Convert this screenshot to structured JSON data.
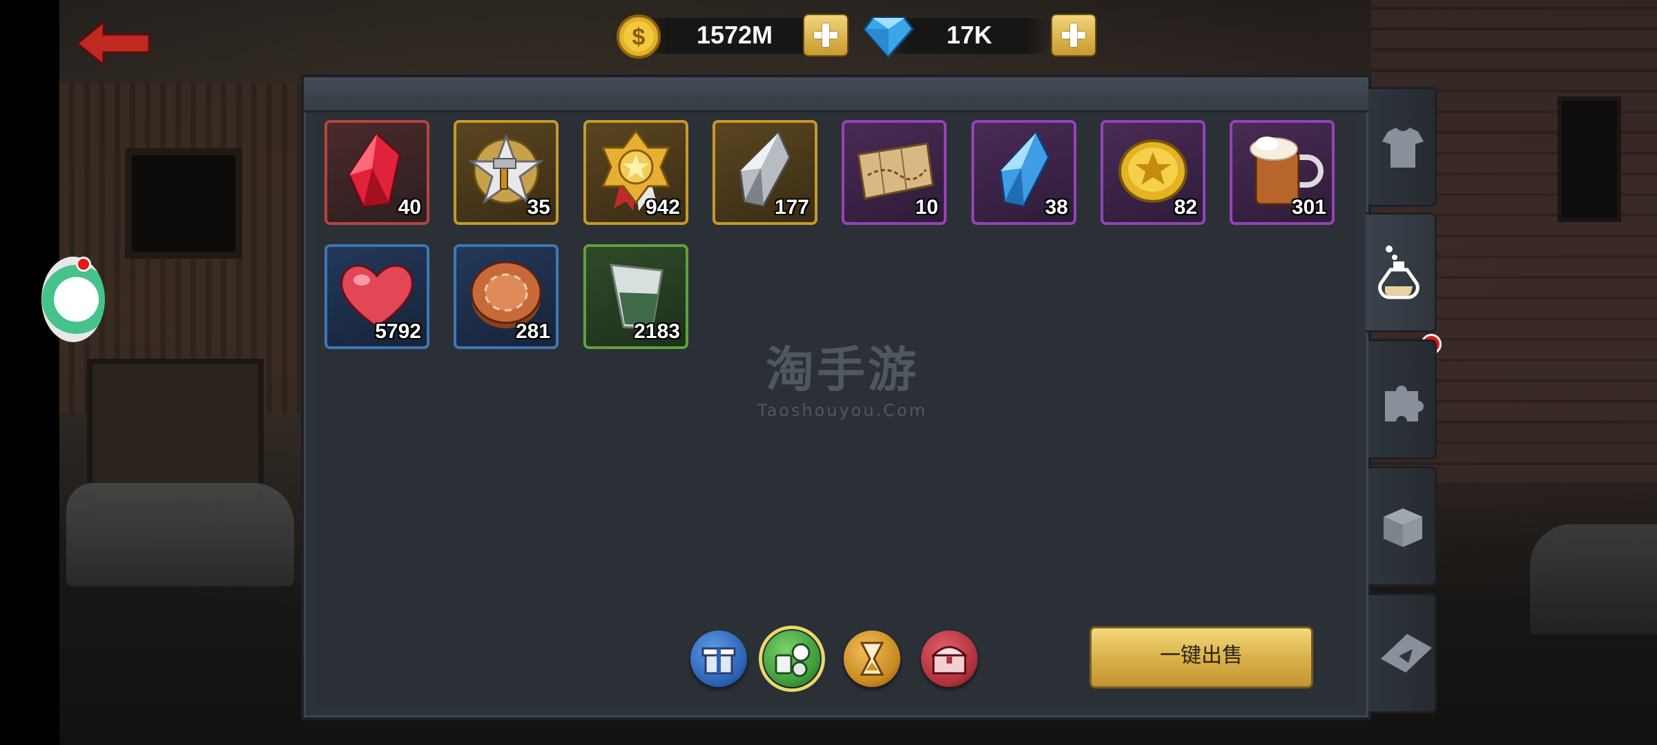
{
  "currency": {
    "gold": {
      "icon": "gold-coin-icon",
      "value": "1572M"
    },
    "diamond": {
      "icon": "diamond-icon",
      "value": "17K"
    }
  },
  "watermark": {
    "main": "淘手游",
    "sub": "Taoshouyou.Com"
  },
  "items": [
    {
      "name": "red-crystal",
      "icon": "red-crystal-icon",
      "count": "40",
      "rarity": "red"
    },
    {
      "name": "silver-hammer-star-medal",
      "icon": "hammer-star-medal-icon",
      "count": "35",
      "rarity": "gold"
    },
    {
      "name": "gold-star-medal",
      "icon": "star-medal-icon",
      "count": "942",
      "rarity": "gold"
    },
    {
      "name": "silver-crystal",
      "icon": "silver-crystal-icon",
      "count": "177",
      "rarity": "gold"
    },
    {
      "name": "treasure-map",
      "icon": "map-icon",
      "count": "10",
      "rarity": "purple"
    },
    {
      "name": "blue-crystal",
      "icon": "blue-crystal-icon",
      "count": "38",
      "rarity": "purple"
    },
    {
      "name": "gold-coin",
      "icon": "gold-coin-icon",
      "count": "82",
      "rarity": "purple"
    },
    {
      "name": "beer-mug",
      "icon": "beer-mug-icon",
      "count": "301",
      "rarity": "purple"
    },
    {
      "name": "heart",
      "icon": "heart-icon",
      "count": "5792",
      "rarity": "blue"
    },
    {
      "name": "poker-chip",
      "icon": "poker-chip-icon",
      "count": "281",
      "rarity": "blue"
    },
    {
      "name": "shot-glass",
      "icon": "shot-glass-icon",
      "count": "2183",
      "rarity": "green"
    }
  ],
  "category_buttons": [
    {
      "icon": "gift-box-icon",
      "color": "#2c63b5",
      "selected": false
    },
    {
      "icon": "consumables-icon",
      "color": "#3e9a3a",
      "selected": true
    },
    {
      "icon": "hourglass-icon",
      "color": "#c8881f",
      "selected": false
    },
    {
      "icon": "treasure-chest-icon",
      "color": "#b0323c",
      "selected": false
    }
  ],
  "sell_button": {
    "label": "一键出售"
  },
  "side_tabs": [
    {
      "icon": "shirt-icon",
      "active": false
    },
    {
      "icon": "potion-icon",
      "active": true,
      "badge": true
    },
    {
      "icon": "puzzle-icon",
      "active": false
    },
    {
      "icon": "box-icon",
      "active": false
    },
    {
      "icon": "ticket-icon",
      "active": false
    }
  ]
}
